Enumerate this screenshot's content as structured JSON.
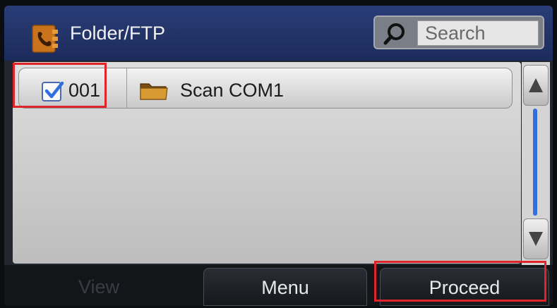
{
  "header": {
    "title": "Folder/FTP",
    "icon": "address-book-icon"
  },
  "search": {
    "placeholder": "Search",
    "icon": "search-icon"
  },
  "list": {
    "items": [
      {
        "number": "001",
        "name": "Scan COM1",
        "checked": true,
        "icon": "folder-icon"
      }
    ]
  },
  "scrollbar": {
    "up_icon": "arrow-up-icon",
    "down_icon": "arrow-down-icon"
  },
  "footer": {
    "view_label": "View",
    "menu_label": "Menu",
    "proceed_label": "Proceed"
  },
  "colors": {
    "header_bg": "#1c2b5a",
    "highlight": "#e0242a",
    "scroll_track": "#2f6fe0",
    "checkbox_check": "#2f6fe0"
  }
}
